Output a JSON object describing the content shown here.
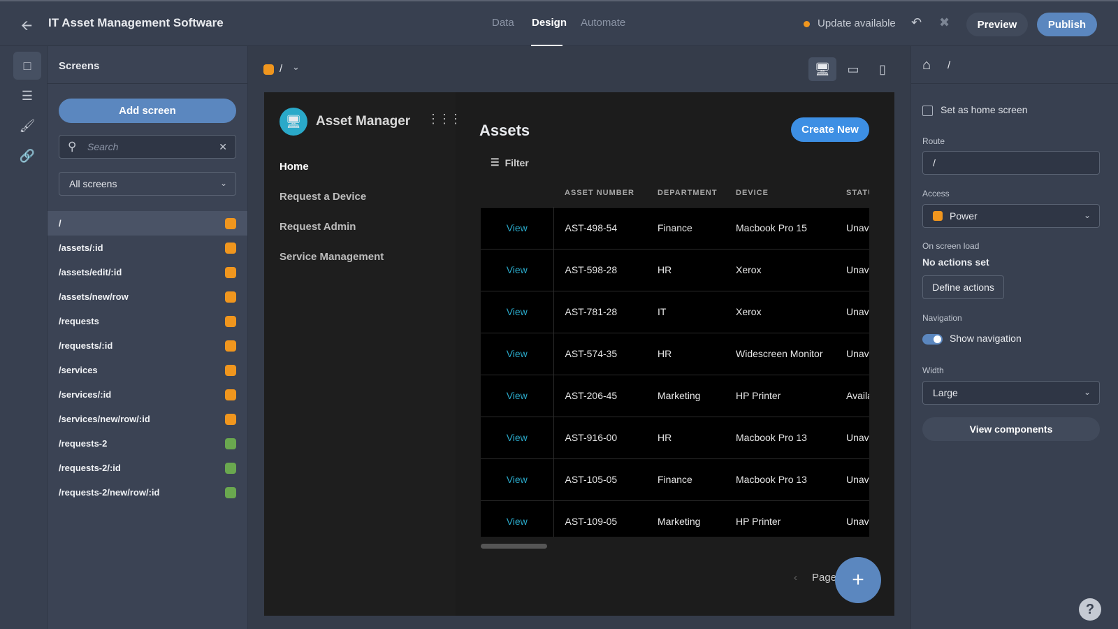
{
  "header": {
    "title": "IT Asset Management Software",
    "tabs": [
      {
        "label": "Data"
      },
      {
        "label": "Design",
        "active": true
      },
      {
        "label": "Automate"
      }
    ],
    "update": "Update available",
    "preview": "Preview",
    "publish": "Publish"
  },
  "colors": {
    "accent": "#5b87bf",
    "orange": "#f0961e",
    "green": "#6aa84f",
    "link": "#2aa9c9",
    "createNew": "#3d8fe4"
  },
  "screens": {
    "title": "Screens",
    "add": "Add screen",
    "search_placeholder": "Search",
    "filter": "All screens",
    "items": [
      {
        "route": "/",
        "color": "orange",
        "selected": true
      },
      {
        "route": "/assets/:id",
        "color": "orange"
      },
      {
        "route": "/assets/edit/:id",
        "color": "orange"
      },
      {
        "route": "/assets/new/row",
        "color": "orange"
      },
      {
        "route": "/requests",
        "color": "orange"
      },
      {
        "route": "/requests/:id",
        "color": "orange"
      },
      {
        "route": "/services",
        "color": "orange"
      },
      {
        "route": "/services/:id",
        "color": "orange"
      },
      {
        "route": "/services/new/row/:id",
        "color": "orange"
      },
      {
        "route": "/requests-2",
        "color": "green"
      },
      {
        "route": "/requests-2/:id",
        "color": "green"
      },
      {
        "route": "/requests-2/new/row/:id",
        "color": "green"
      }
    ]
  },
  "canvas": {
    "route": "/"
  },
  "app": {
    "name": "Asset Manager",
    "nav": [
      "Home",
      "Request a Device",
      "Request Admin",
      "Service Management"
    ],
    "page_title": "Assets",
    "create": "Create New",
    "filter": "Filter",
    "page": "Page",
    "columns": [
      "",
      "ASSET NUMBER",
      "DEPARTMENT",
      "DEVICE",
      "STATUS"
    ],
    "rows": [
      [
        "View",
        "AST-498-54",
        "Finance",
        "Macbook Pro 15",
        "Unavailable"
      ],
      [
        "View",
        "AST-598-28",
        "HR",
        "Xerox",
        "Unavailable"
      ],
      [
        "View",
        "AST-781-28",
        "IT",
        "Xerox",
        "Unavailable"
      ],
      [
        "View",
        "AST-574-35",
        "HR",
        "Widescreen Monitor",
        "Unavailable"
      ],
      [
        "View",
        "AST-206-45",
        "Marketing",
        "HP Printer",
        "Available"
      ],
      [
        "View",
        "AST-916-00",
        "HR",
        "Macbook Pro 13",
        "Unavailable"
      ],
      [
        "View",
        "AST-105-05",
        "Finance",
        "Macbook Pro 13",
        "Unavailable"
      ],
      [
        "View",
        "AST-109-05",
        "Marketing",
        "HP Printer",
        "Unavailable"
      ]
    ]
  },
  "settings": {
    "route_crumb": "/",
    "home_checkbox": "Set as home screen",
    "home_checked": false,
    "route_label": "Route",
    "route_value": "/",
    "access_label": "Access",
    "access_value": "Power",
    "load_label": "On screen load",
    "no_actions": "No actions set",
    "define": "Define actions",
    "nav_label": "Navigation",
    "show_nav": "Show navigation",
    "show_nav_on": true,
    "width_label": "Width",
    "width_value": "Large",
    "view_components": "View components"
  }
}
